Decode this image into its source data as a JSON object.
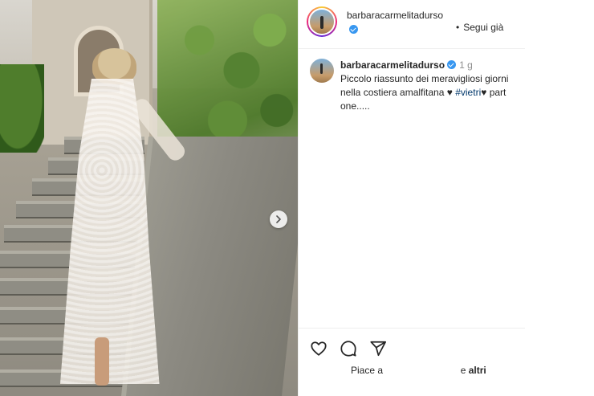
{
  "post": {
    "username": "barbaracarmelitadurso",
    "follow_label": "Segui già",
    "follow_separator": "•",
    "caption": {
      "username": "barbaracarmelitadurso",
      "time": "1 g",
      "text_part1": "Piccolo riassunto dei meravigliosi giorni nella costiera amalfitana ",
      "heart1": "♥",
      "hashtag": "#vietri",
      "heart2": "♥",
      "text_part2": " part one....."
    },
    "likes": {
      "prefix": "Piace a",
      "mid": "e",
      "bold": "altri"
    }
  },
  "icons": {
    "like": "heart-outline-icon",
    "comment": "comment-bubble-icon",
    "share": "paper-plane-icon",
    "next": "chevron-right-icon",
    "verified": "verified-badge-icon"
  },
  "colors": {
    "verified": "#3897f0",
    "hashtag": "#00376b",
    "muted": "#8e8e8e"
  }
}
